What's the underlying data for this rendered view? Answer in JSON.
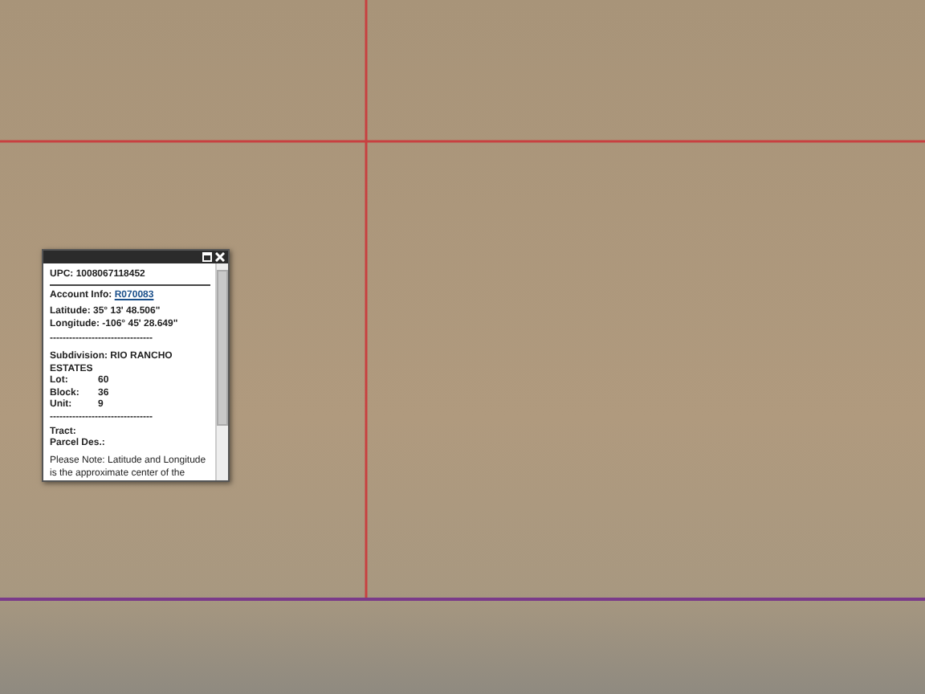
{
  "popup": {
    "upc": "UPC: 1008067118452",
    "account_label": "Account Info:",
    "account_link": "R070083",
    "latitude": "Latitude: 35° 13' 48.506\"",
    "longitude": "Longitude: -106° 45' 28.649\"",
    "separator": "--------------------------------",
    "subdivision": "Subdivision: RIO RANCHO ESTATES",
    "fields": [
      {
        "label": "Lot:",
        "value": "60"
      },
      {
        "label": "Block:",
        "value": "36"
      },
      {
        "label": "Unit:",
        "value": "9"
      }
    ],
    "separator_2": "--------------------------------",
    "tract": "Tract:",
    "parcel_des": "Parcel Des.:",
    "note": "Please Note: Latitude and Longitude is the approximate center of the"
  }
}
